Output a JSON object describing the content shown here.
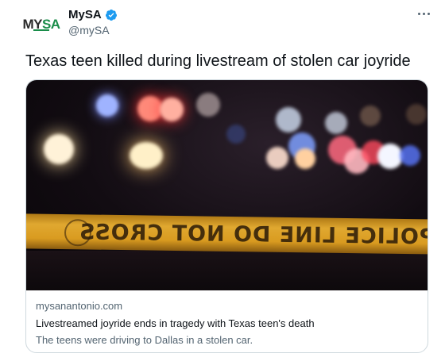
{
  "author": {
    "display_name": "MySA",
    "handle": "@mySA",
    "verified": true,
    "avatar_logo_prefix": "MY",
    "avatar_logo_suffix": "SA",
    "brand_color": "#1a8d4a",
    "verified_color": "#1d9bf0"
  },
  "more_icon": "more-horizontal-icon",
  "tweet": {
    "text": "Texas teen killed during livestream of stolen car joyride"
  },
  "card": {
    "image_tape_text": "POLICE LINE DO NOT CROSS",
    "domain": "mysanantonio.com",
    "title": "Livestreamed joyride ends in tragedy with Texas teen's death",
    "description": "The teens were driving to Dallas in a stolen car."
  }
}
